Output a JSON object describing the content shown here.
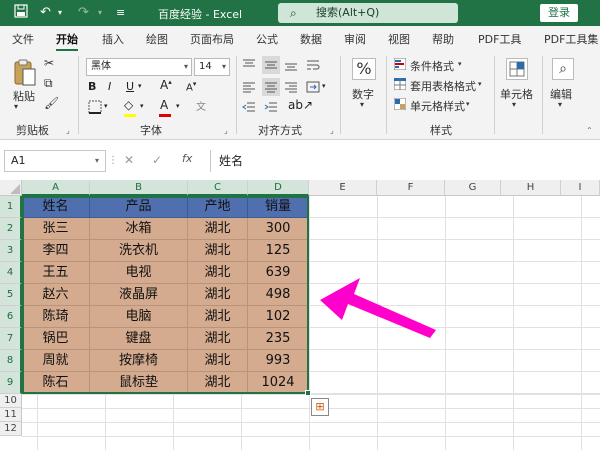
{
  "titlebar": {
    "title": "百度经验 - Excel",
    "search_placeholder": "搜索(Alt+Q)",
    "login_label": "登录"
  },
  "menu": {
    "tabs": [
      {
        "label": "文件"
      },
      {
        "label": "开始"
      },
      {
        "label": "插入"
      },
      {
        "label": "绘图"
      },
      {
        "label": "页面布局"
      },
      {
        "label": "公式"
      },
      {
        "label": "数据"
      },
      {
        "label": "审阅"
      },
      {
        "label": "视图"
      },
      {
        "label": "帮助"
      },
      {
        "label": "PDF工具"
      },
      {
        "label": "PDF工具集"
      }
    ],
    "active_tab": "开始"
  },
  "ribbon": {
    "clipboard": {
      "paste_label": "粘贴",
      "group_label": "剪贴板"
    },
    "font": {
      "font_name": "黑体",
      "font_size": "14",
      "bold": "B",
      "italic": "I",
      "underline": "U",
      "group_label": "字体"
    },
    "alignment": {
      "group_label": "对齐方式"
    },
    "number": {
      "label": "数字"
    },
    "styles": {
      "conditional": "条件格式",
      "table": "套用表格格式",
      "cell": "单元格样式",
      "group_label": "样式"
    },
    "cells": {
      "label": "单元格"
    },
    "edit": {
      "label": "编辑"
    }
  },
  "formula_bar": {
    "name_box": "A1",
    "fx": "fx",
    "content": "姓名"
  },
  "grid": {
    "columns": [
      "A",
      "B",
      "C",
      "D",
      "E",
      "F",
      "G",
      "H",
      "I"
    ],
    "rows": [
      "1",
      "2",
      "3",
      "4",
      "5",
      "6",
      "7",
      "8",
      "9",
      "10",
      "11",
      "12"
    ],
    "header": [
      "姓名",
      "产品",
      "产地",
      "销量"
    ],
    "data": [
      [
        "张三",
        "冰箱",
        "湖北",
        "300"
      ],
      [
        "李四",
        "洗衣机",
        "湖北",
        "125"
      ],
      [
        "王五",
        "电视",
        "湖北",
        "639"
      ],
      [
        "赵六",
        "液晶屏",
        "湖北",
        "498"
      ],
      [
        "陈琦",
        "电脑",
        "湖北",
        "102"
      ],
      [
        "锅巴",
        "键盘",
        "湖北",
        "235"
      ],
      [
        "周就",
        "按摩椅",
        "湖北",
        "993"
      ],
      [
        "陈石",
        "鼠标垫",
        "湖北",
        "1024"
      ]
    ]
  },
  "colors": {
    "excel_green": "#217346",
    "header_fill": "#4f6fae",
    "body_fill": "#d4ab8f",
    "arrow": "#ff00cc"
  }
}
